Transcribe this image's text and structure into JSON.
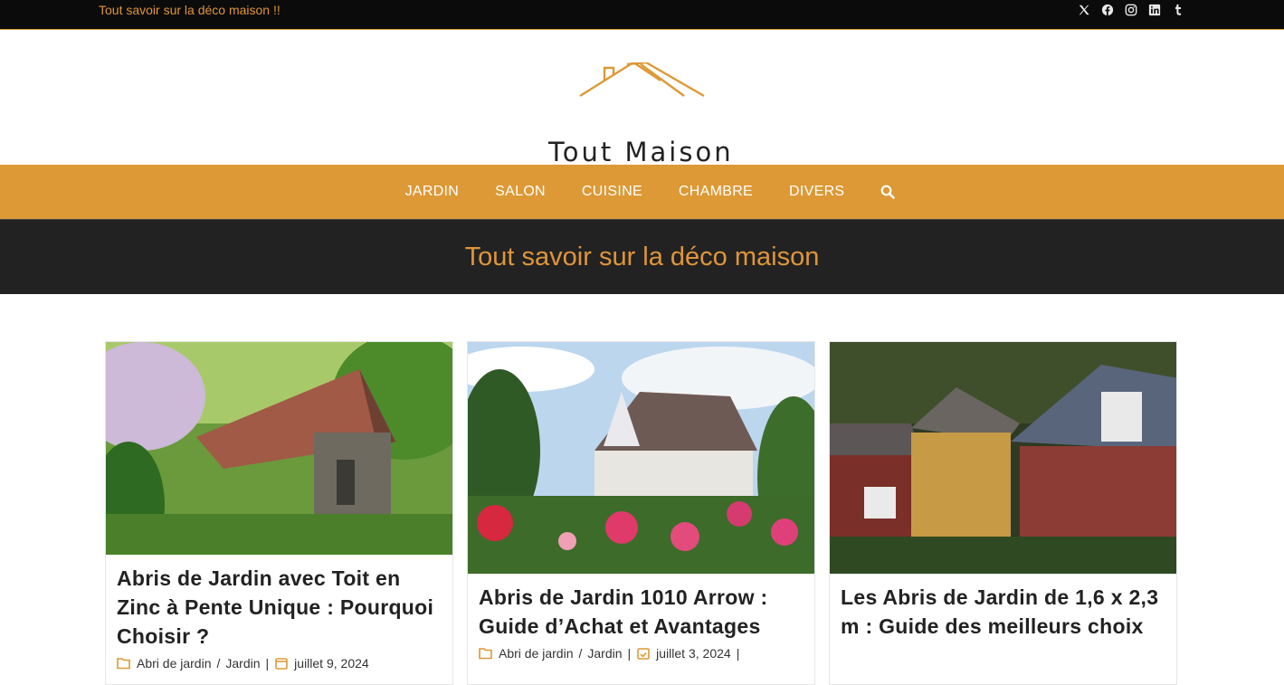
{
  "topbar": {
    "tagline": "Tout savoir sur la déco maison !!",
    "socials": [
      "x-icon",
      "facebook-icon",
      "instagram-icon",
      "linkedin-icon",
      "tumblr-icon"
    ]
  },
  "logo": {
    "text": "Tout Maison",
    "accent": "#dd9935"
  },
  "nav": {
    "items": [
      "JARDIN",
      "SALON",
      "CUISINE",
      "CHAMBRE",
      "DIVERS"
    ],
    "search_icon": "search-icon"
  },
  "hero": {
    "title": "Tout savoir sur la déco maison"
  },
  "colors": {
    "accent": "#dd9935",
    "dark": "#222222",
    "topbar": "#0b0b0b"
  },
  "posts": [
    {
      "title": "Abris de Jardin avec Toit en Zinc à Pente Unique : Pourquoi Choisir ?",
      "category_1": "Abri de jardin",
      "category_2": "Jardin",
      "date": "juillet 9, 2024"
    },
    {
      "title": "Abris de Jardin 1010 Arrow : Guide d’Achat et Avantages",
      "category_1": "Abri de jardin",
      "category_2": "Jardin",
      "date": "juillet 3, 2024"
    },
    {
      "title": "Les Abris de Jardin de 1,6 x 2,3 m : Guide des meilleurs choix",
      "category_1": "",
      "category_2": "",
      "date": ""
    }
  ]
}
